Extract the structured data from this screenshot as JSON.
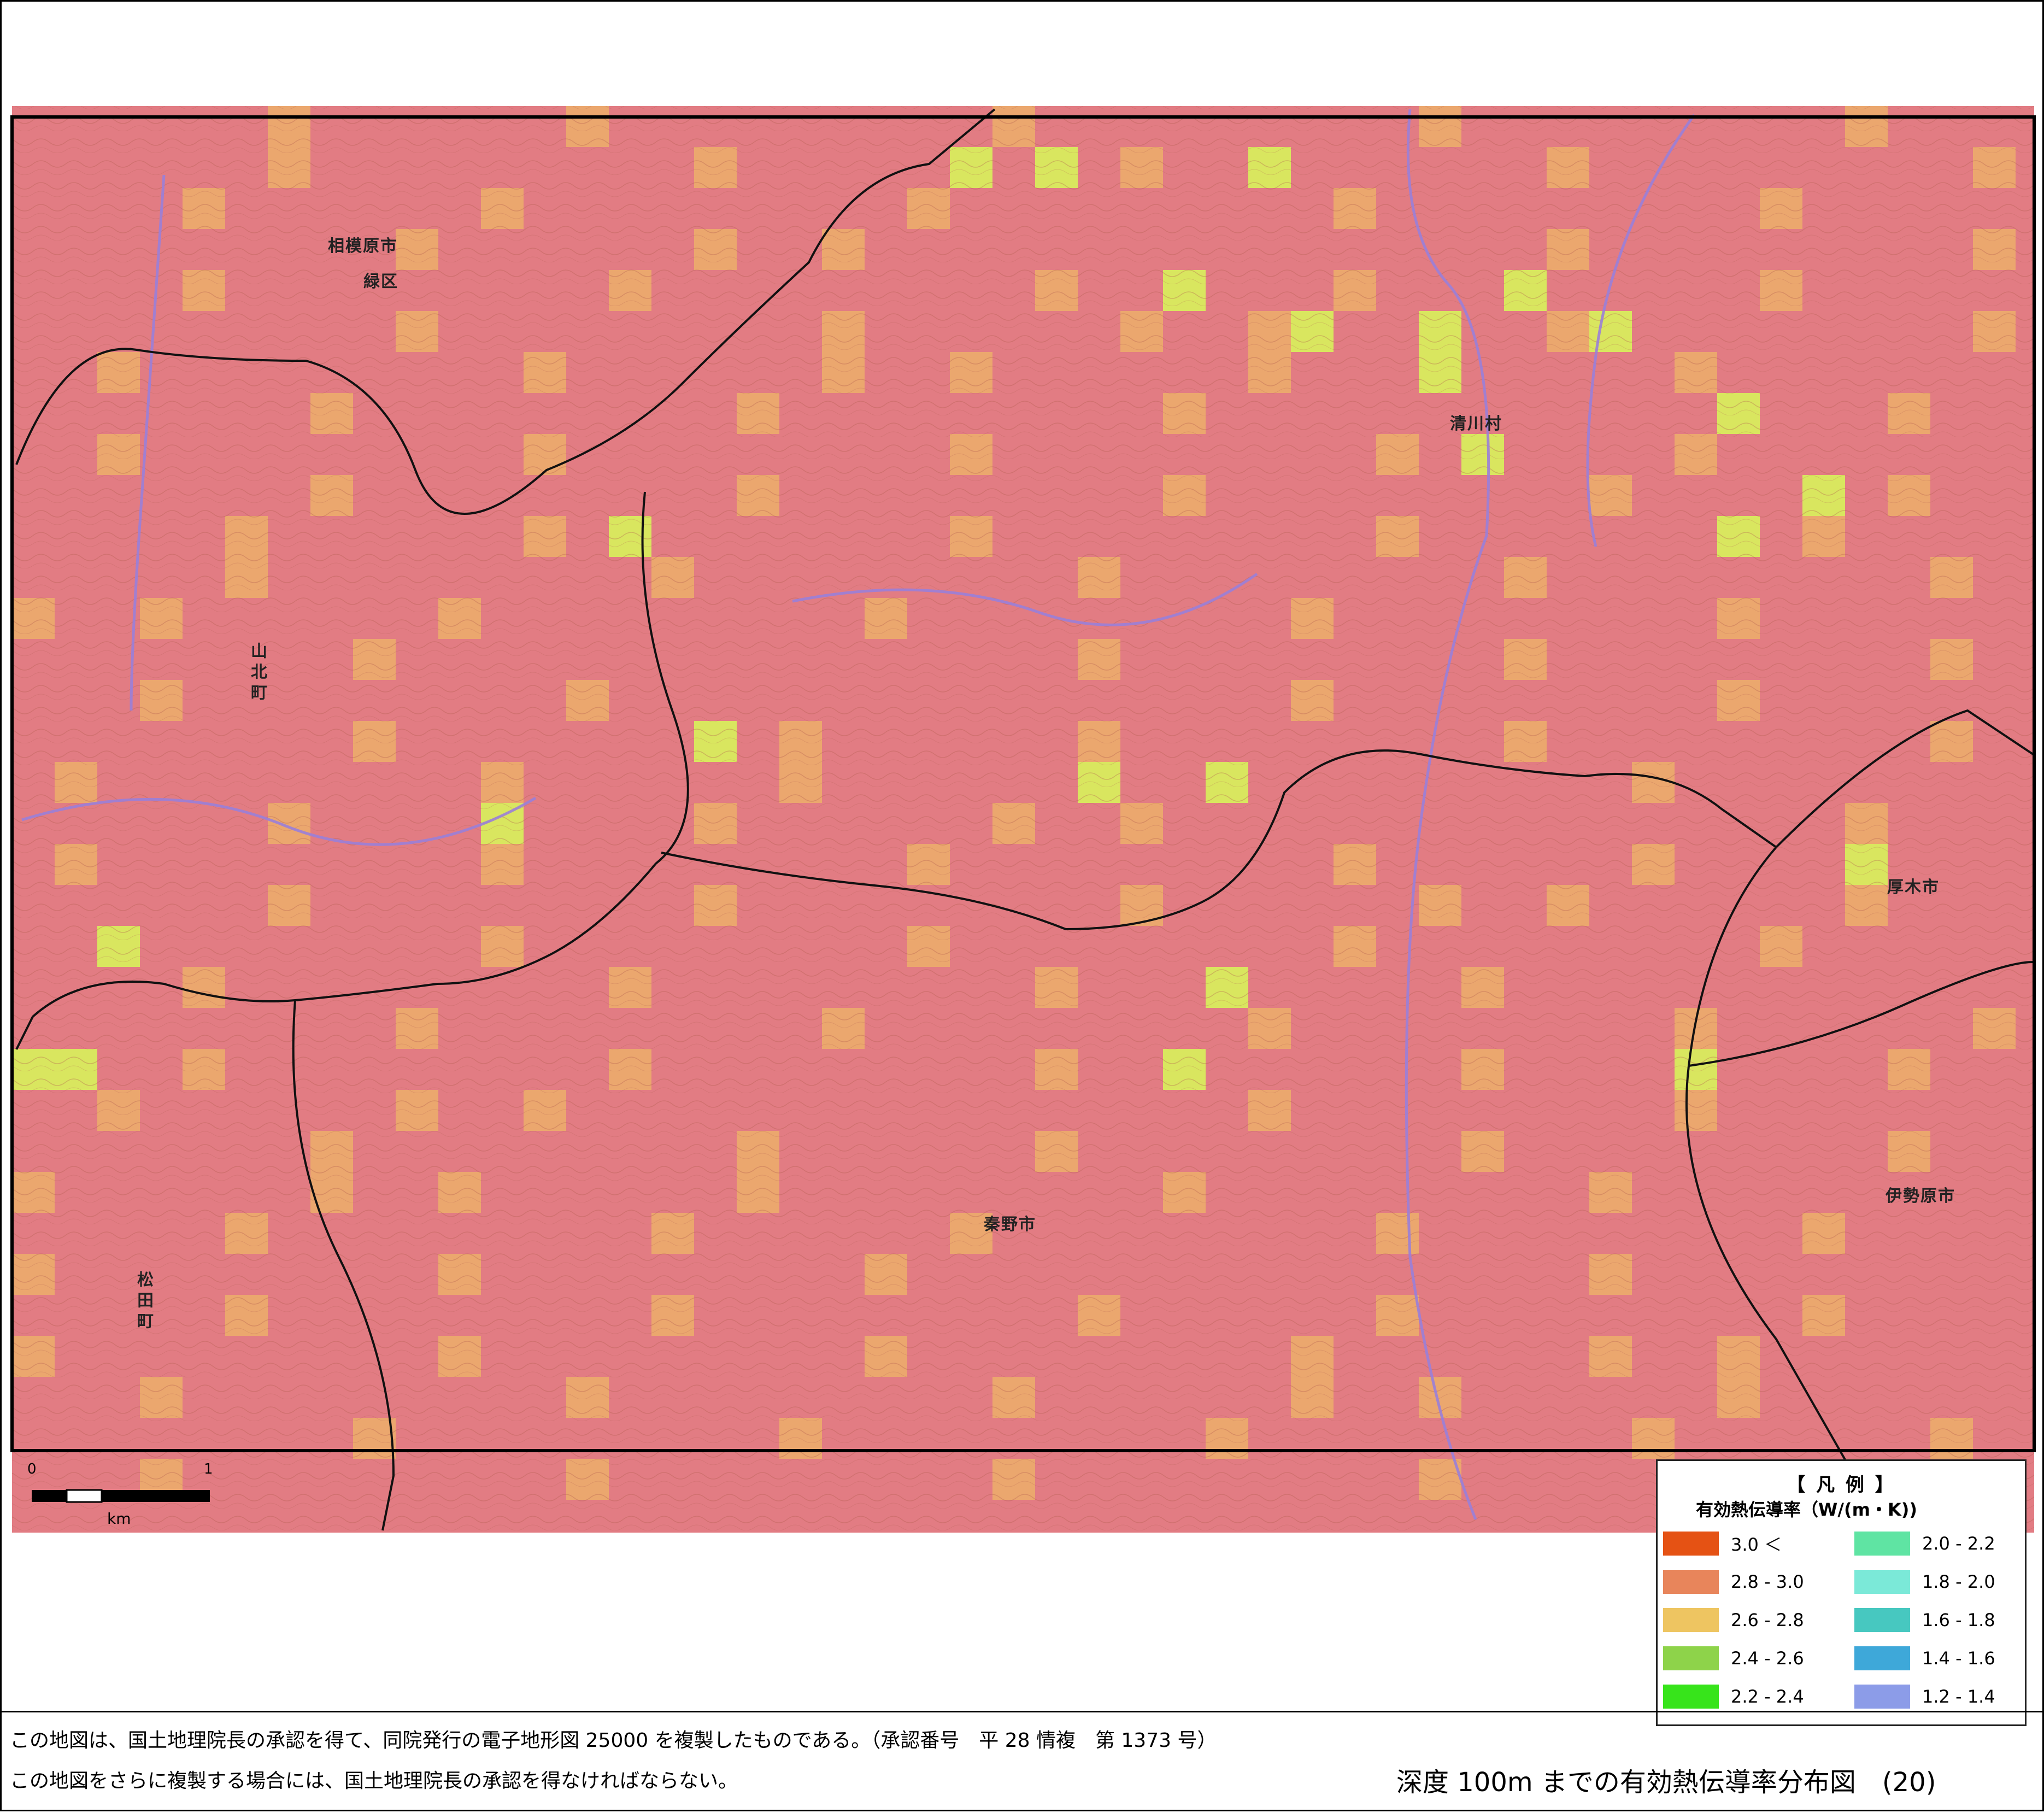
{
  "palette": {
    "background": "#e27c83",
    "very_high": "#e55214",
    "high": "#e8855b",
    "mid": "#eba76e",
    "low": "#d9e65f",
    "road": "#111111",
    "river": "#9a80d8",
    "contour": "#b15a4e"
  },
  "map": {
    "place_names": [
      {
        "id": "sagamihara",
        "text": "相模原市",
        "vertical": false
      },
      {
        "id": "midori-ku",
        "text": "緑区",
        "vertical": false
      },
      {
        "id": "kiyokawa",
        "text": "清川村",
        "vertical": false
      },
      {
        "id": "yamakita",
        "text": "山北町",
        "vertical": true
      },
      {
        "id": "atsugi",
        "text": "厚木市",
        "vertical": false
      },
      {
        "id": "hadano",
        "text": "秦野市",
        "vertical": false
      },
      {
        "id": "isehara",
        "text": "伊勢原市",
        "vertical": false
      },
      {
        "id": "matsuda",
        "text": "松田町",
        "vertical": true
      }
    ],
    "cells": {
      "mid": [
        [
          45,
          3
        ],
        [
          50,
          3
        ],
        [
          55,
          3
        ],
        [
          60,
          3
        ],
        [
          65,
          3
        ],
        [
          70,
          3
        ],
        [
          105,
          3
        ],
        [
          110,
          3
        ],
        [
          115,
          3
        ],
        [
          120,
          3
        ],
        [
          125,
          3
        ],
        [
          130,
          3
        ],
        [
          135,
          3
        ],
        [
          140,
          3
        ],
        [
          145,
          3
        ],
        [
          150,
          3
        ],
        [
          155,
          3
        ],
        [
          160,
          3
        ],
        [
          165,
          3
        ],
        [
          170,
          3
        ],
        [
          175,
          3
        ],
        [
          215,
          3
        ],
        [
          220,
          3
        ],
        [
          225,
          3
        ],
        [
          230,
          3
        ],
        [
          235,
          3
        ],
        [
          240,
          3
        ],
        [
          245,
          3
        ],
        [
          250,
          3
        ],
        [
          255,
          3
        ],
        [
          260,
          3
        ],
        [
          265,
          3
        ],
        [
          270,
          3
        ],
        [
          275,
          3
        ],
        [
          295,
          3
        ],
        [
          300,
          3
        ],
        [
          305,
          3
        ],
        [
          310,
          3
        ],
        [
          315,
          3
        ],
        [
          320,
          3
        ],
        [
          325,
          3
        ],
        [
          330,
          3
        ],
        [
          335,
          3
        ],
        [
          340,
          3
        ],
        [
          345,
          3
        ],
        [
          350,
          3
        ],
        [
          355,
          3
        ],
        [
          360,
          3
        ],
        [
          365,
          3
        ],
        [
          370,
          3
        ],
        [
          375,
          3
        ],
        [
          380,
          3
        ],
        [
          385,
          3
        ],
        [
          390,
          3
        ],
        [
          395,
          3
        ],
        [
          400,
          3
        ],
        [
          405,
          3
        ],
        [
          410,
          3
        ],
        [
          415,
          3
        ],
        [
          420,
          3
        ],
        [
          425,
          3
        ],
        [
          430,
          3
        ],
        [
          435,
          3
        ],
        [
          440,
          3
        ],
        [
          445,
          3
        ],
        [
          450,
          3
        ],
        [
          455,
          3
        ],
        [
          460,
          3
        ],
        [
          465,
          3
        ],
        [
          470,
          3
        ],
        [
          475,
          3
        ],
        [
          480,
          3
        ],
        [
          485,
          3
        ],
        [
          490,
          3
        ],
        [
          495,
          3
        ],
        [
          500,
          3
        ],
        [
          505,
          3
        ],
        [
          510,
          3
        ],
        [
          515,
          3
        ],
        [
          520,
          3
        ],
        [
          525,
          3
        ],
        [
          530,
          3
        ],
        [
          535,
          3
        ],
        [
          540,
          3
        ],
        [
          545,
          3
        ],
        [
          550,
          3
        ],
        [
          555,
          3
        ],
        [
          560,
          3
        ],
        [
          565,
          3
        ],
        [
          570,
          3
        ],
        [
          575,
          3
        ],
        [
          580,
          3
        ],
        [
          585,
          3
        ],
        [
          590,
          3
        ],
        [
          595,
          3
        ],
        [
          600,
          3
        ],
        [
          605,
          3
        ],
        [
          610,
          3
        ],
        [
          615,
          3
        ],
        [
          620,
          3
        ],
        [
          625,
          3
        ],
        [
          630,
          3
        ],
        [
          635,
          3
        ],
        [
          640,
          3
        ],
        [
          645,
          3
        ],
        [
          650,
          3
        ],
        [
          655,
          3
        ],
        [
          660,
          3
        ],
        [
          665,
          3
        ],
        [
          670,
          3
        ],
        [
          675,
          3
        ],
        [
          680,
          3
        ],
        [
          685,
          3
        ],
        [
          690,
          3
        ],
        [
          695,
          3
        ],
        [
          700,
          3
        ],
        [
          705,
          3
        ],
        [
          710,
          3
        ],
        [
          715,
          3
        ],
        [
          720,
          3
        ],
        [
          725,
          3
        ],
        [
          730,
          3
        ],
        [
          735,
          3
        ],
        [
          740,
          3
        ],
        [
          745,
          3
        ],
        [
          750,
          3
        ],
        [
          755,
          3
        ],
        [
          760,
          3
        ],
        [
          765,
          3
        ],
        [
          770,
          3
        ],
        [
          775,
          3
        ],
        [
          780,
          3
        ],
        [
          785,
          3
        ],
        [
          790,
          3
        ],
        [
          795,
          3
        ],
        [
          800,
          3
        ],
        [
          805,
          3
        ],
        [
          810,
          3
        ],
        [
          815,
          3
        ],
        [
          820,
          3
        ],
        [
          825,
          3
        ],
        [
          830,
          3
        ],
        [
          835,
          3
        ],
        [
          840,
          3
        ],
        [
          845,
          3
        ],
        [
          850,
          3
        ],
        [
          855,
          3
        ],
        [
          860,
          3
        ],
        [
          865,
          3
        ],
        [
          870,
          3
        ],
        [
          875,
          3
        ],
        [
          880,
          3
        ],
        [
          885,
          3
        ],
        [
          890,
          3
        ],
        [
          895,
          3
        ],
        [
          900,
          3
        ],
        [
          905,
          3
        ],
        [
          910,
          3
        ],
        [
          915,
          3
        ],
        [
          920,
          3
        ],
        [
          925,
          3
        ],
        [
          930,
          3
        ],
        [
          935,
          3
        ],
        [
          940,
          3
        ],
        [
          945,
          3
        ],
        [
          950,
          3
        ],
        [
          955,
          3
        ],
        [
          960,
          3
        ],
        [
          965,
          3
        ],
        [
          970,
          3
        ],
        [
          975,
          3
        ],
        [
          980,
          3
        ],
        [
          985,
          3
        ],
        [
          990,
          3
        ],
        [
          995,
          3
        ],
        [
          1000,
          3
        ]
      ],
      "low": [
        [
          22,
          1
        ],
        [
          24,
          1
        ],
        [
          29,
          1
        ],
        [
          27,
          4
        ],
        [
          35,
          4
        ],
        [
          37,
          5
        ],
        [
          30,
          5
        ],
        [
          33,
          5
        ],
        [
          33,
          6
        ],
        [
          40,
          7
        ],
        [
          34,
          8
        ],
        [
          42,
          9
        ],
        [
          14,
          10
        ],
        [
          40,
          10
        ],
        [
          16,
          15
        ],
        [
          25,
          16
        ],
        [
          28,
          16
        ],
        [
          11,
          17
        ],
        [
          43,
          18
        ],
        [
          2,
          20
        ],
        [
          28,
          21
        ],
        [
          0,
          23
        ],
        [
          39,
          23
        ],
        [
          27,
          23
        ],
        [
          1,
          23
        ]
      ]
    }
  },
  "legend": {
    "title": "【 凡 例 】",
    "subtitle": "有効熱伝導率（W/(m・K))",
    "items": [
      {
        "label": "3.0 ＜",
        "color": "#e55214"
      },
      {
        "label": "2.8 - 3.0",
        "color": "#e8855b"
      },
      {
        "label": "2.6 - 2.8",
        "color": "#eec561"
      },
      {
        "label": "2.4 - 2.6",
        "color": "#8ed34a"
      },
      {
        "label": "2.2 - 2.4",
        "color": "#37e41b"
      },
      {
        "label": "2.0 - 2.2",
        "color": "#5fe4a3"
      },
      {
        "label": "1.8 - 2.0",
        "color": "#7be9d8"
      },
      {
        "label": "1.6 - 1.8",
        "color": "#47c8c0"
      },
      {
        "label": "1.4 - 1.6",
        "color": "#3ea8d9"
      },
      {
        "label": "1.2 - 1.4",
        "color": "#8c9ce8"
      }
    ]
  },
  "scale_bar": {
    "zero": "0",
    "one": "1",
    "unit": "km"
  },
  "footer": {
    "line1": "この地図は、国土地理院長の承認を得て、同院発行の電子地形図 25000 を複製したものである。（承認番号　平 28 情複　第 1373 号）",
    "line2": "この地図をさらに複製する場合には、国土地理院長の承認を得なければならない。",
    "title": "深度 100m までの有効熱伝導率分布図　(20)"
  }
}
